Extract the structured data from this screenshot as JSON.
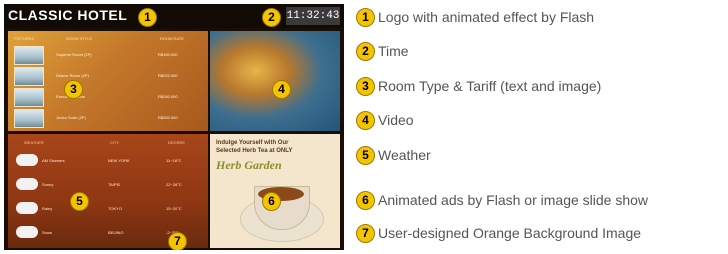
{
  "screen": {
    "logo": "CLASSIC HOTEL",
    "time": "11:32:43",
    "room_table": {
      "headers": [
        "PICTURES",
        "ROOM STYLE",
        "ROOM RATE"
      ],
      "rows": [
        {
          "style": "Superior Room (2P)",
          "rate": "R$180.000"
        },
        {
          "style": "Deluxe Room (2P)",
          "rate": "R$220.000"
        },
        {
          "style": "Executive Room",
          "rate": "R$280.000"
        },
        {
          "style": "Junior Suite (2P)",
          "rate": "R$350.000"
        }
      ]
    },
    "weather_table": {
      "headers": [
        "WEATHER",
        "CITY",
        "DEGREE"
      ],
      "rows": [
        {
          "desc": "AM Showers",
          "city": "NEW YORK",
          "deg": "11~18°C"
        },
        {
          "desc": "Sunny",
          "city": "TAIPEI",
          "deg": "22~28°C"
        },
        {
          "desc": "Rainy",
          "city": "TOKYO",
          "deg": "15~20°C"
        },
        {
          "desc": "Snow",
          "city": "BEIJING",
          "deg": "-2~3°C"
        }
      ]
    },
    "ad": {
      "line1": "Indulge Yourself with Our",
      "line2": "Selected Herb Tea at ONLY",
      "title": "Herb Garden"
    },
    "badges": [
      "1",
      "2",
      "3",
      "4",
      "5",
      "6",
      "7"
    ]
  },
  "legend": [
    {
      "num": "1",
      "text": "Logo with animated effect by Flash"
    },
    {
      "num": "2",
      "text": "Time"
    },
    {
      "num": "3",
      "text": "Room Type & Tariff (text and image)"
    },
    {
      "num": "4",
      "text": "Video"
    },
    {
      "num": "5",
      "text": "Weather"
    },
    {
      "num": "6",
      "text": "Animated ads by Flash or image slide show"
    },
    {
      "num": "7",
      "text": "User-designed Orange Background Image"
    }
  ],
  "colors": {
    "badge": "#f5c400",
    "legend_text": "#555555",
    "background": "#1a0d05"
  }
}
